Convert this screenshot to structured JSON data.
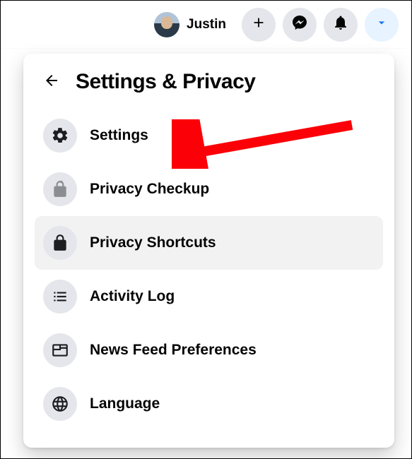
{
  "header": {
    "profile_name": "Justin"
  },
  "panel": {
    "title": "Settings & Privacy",
    "items": [
      {
        "label": "Settings"
      },
      {
        "label": "Privacy Checkup"
      },
      {
        "label": "Privacy Shortcuts"
      },
      {
        "label": "Activity Log"
      },
      {
        "label": "News Feed Preferences"
      },
      {
        "label": "Language"
      }
    ]
  },
  "colors": {
    "accent": "#1877f2",
    "annotation": "#fb0007"
  }
}
